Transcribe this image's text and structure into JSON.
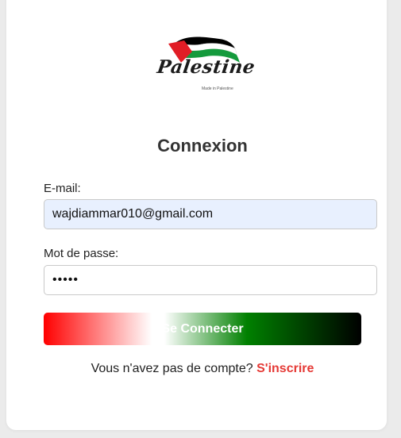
{
  "logo": {
    "script_text": "Palestine",
    "tagline": "Made in Palestine",
    "flag_colors": [
      "#e11d26",
      "#000000",
      "#ffffff",
      "#149a3c"
    ]
  },
  "form": {
    "title": "Connexion",
    "email_label": "E-mail:",
    "email_value": "wajdiammar010@gmail.com",
    "password_label": "Mot de passe:",
    "password_value": "•••••",
    "submit_label": "Se Connecter"
  },
  "footer": {
    "prompt": "Vous n'avez pas de compte?",
    "link_label": "S'inscrire"
  },
  "colors": {
    "link": "#e53935",
    "email_field_bg": "#e8f0fe",
    "title": "#333333"
  }
}
